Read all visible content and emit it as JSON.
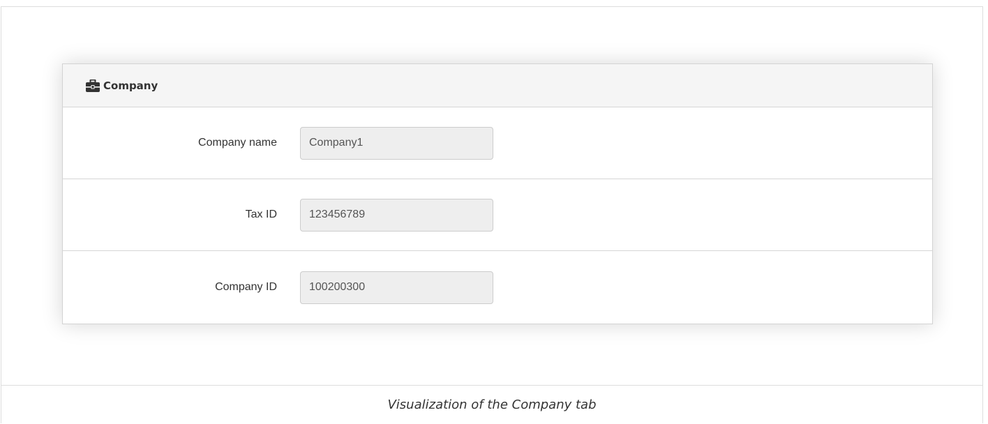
{
  "panel": {
    "title": "Company",
    "icon": "briefcase-icon"
  },
  "fields": [
    {
      "label": "Company name",
      "value": "Company1"
    },
    {
      "label": "Tax ID",
      "value": "123456789"
    },
    {
      "label": "Company ID",
      "value": "100200300"
    }
  ],
  "caption": "Visualization of the Company tab"
}
